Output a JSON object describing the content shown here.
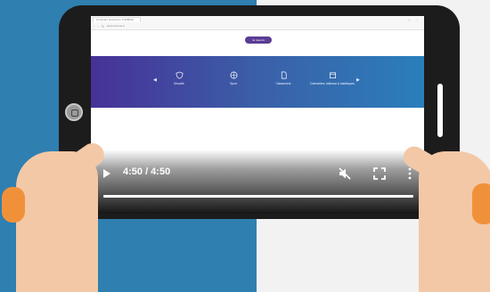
{
  "browser": {
    "tab_title": "Comment fonctionne TORMINA",
    "url": "www.tormina.fr",
    "nav_icons": "‹ › ↻",
    "toolbar_icons": "☆ ⋮"
  },
  "page": {
    "cta_label": "Je réserve",
    "features": [
      {
        "icon": "shield-icon",
        "label": "Sécurité"
      },
      {
        "icon": "basketball-icon",
        "label": "Sport"
      },
      {
        "icon": "document-icon",
        "label": "Classement"
      },
      {
        "icon": "calendar-icon",
        "label": "Calendriers, tableaux & statistiques"
      }
    ]
  },
  "video": {
    "time": "4:50 / 4:50",
    "progress": 1.0
  },
  "colors": {
    "background_left": "#2f7fb0",
    "banner_start": "#473197",
    "banner_end": "#2a7fbb",
    "accent": "#5c3c94",
    "skin": "#f3c8a6",
    "sleeve": "#f0913a"
  }
}
